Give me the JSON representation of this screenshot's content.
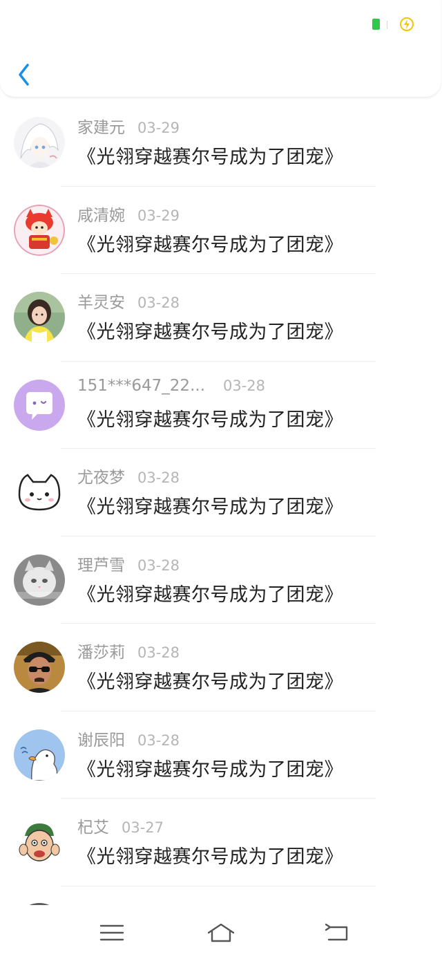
{
  "header": {
    "back_icon": "chevron-left-icon"
  },
  "status": {
    "battery_color": "#2ec84a",
    "charge_color": "#f6c400"
  },
  "comments": [
    {
      "name": "家建元",
      "date": "03-29",
      "text": "《光翎穿越赛尔号成为了团宠》",
      "avatar": "anime-girl-avatar"
    },
    {
      "name": "咸清婉",
      "date": "03-29",
      "text": "《光翎穿越赛尔号成为了团宠》",
      "avatar": "red-cat-avatar"
    },
    {
      "name": "羊灵安",
      "date": "03-28",
      "text": "《光翎穿越赛尔号成为了团宠》",
      "avatar": "girl-photo-avatar"
    },
    {
      "name": "151***647_22...",
      "date": "03-28",
      "text": "《光翎穿越赛尔号成为了团宠》",
      "avatar": "chat-bubble-avatar"
    },
    {
      "name": "尤夜梦",
      "date": "03-28",
      "text": "《光翎穿越赛尔号成为了团宠》",
      "avatar": "white-cat-face-avatar"
    },
    {
      "name": "理芦雪",
      "date": "03-28",
      "text": "《光翎穿越赛尔号成为了团宠》",
      "avatar": "cat-photo-avatar"
    },
    {
      "name": "潘莎莉",
      "date": "03-28",
      "text": "《光翎穿越赛尔号成为了团宠》",
      "avatar": "man-sunglasses-avatar"
    },
    {
      "name": "谢辰阳",
      "date": "03-28",
      "text": "《光翎穿越赛尔号成为了团宠》",
      "avatar": "duck-avatar"
    },
    {
      "name": "杞艾",
      "date": "03-27",
      "text": "《光翎穿越赛尔号成为了团宠》",
      "avatar": "cartoon-boy-avatar"
    }
  ],
  "partial_row": {
    "name": ""
  },
  "navbar": {
    "menu_icon": "menu-icon",
    "home_icon": "home-icon",
    "back_icon": "back-arrow-icon"
  }
}
